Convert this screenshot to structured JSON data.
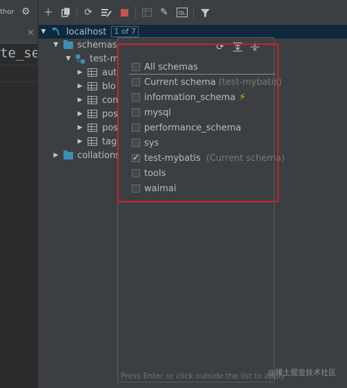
{
  "left": {
    "toolbar_text": "thor",
    "editor_snippet": "te_se"
  },
  "toolbar": {
    "icons": [
      "add-icon",
      "duplicate-icon",
      "refresh-icon",
      "properties-icon",
      "stop-icon",
      "table-view-icon",
      "edit-icon",
      "sql-console-icon",
      "filter-icon"
    ]
  },
  "tree": {
    "host": {
      "label": "localhost",
      "badge": "1 of 7"
    },
    "schemas": {
      "label": "schemas"
    },
    "schema": {
      "label": "test-m"
    },
    "tables": [
      "aut",
      "blo",
      "com",
      "pos",
      "pos",
      "tag"
    ],
    "collations": {
      "label": "collations"
    }
  },
  "popup": {
    "all": {
      "label": "All schemas",
      "checked": false
    },
    "current": {
      "label": "Current schema",
      "note": "(test-mybatis)",
      "checked": false
    },
    "options": [
      {
        "label": "information_schema",
        "checked": false,
        "note": ""
      },
      {
        "label": "mysql",
        "checked": false,
        "note": ""
      },
      {
        "label": "performance_schema",
        "checked": false,
        "note": ""
      },
      {
        "label": "sys",
        "checked": false,
        "note": ""
      },
      {
        "label": "test-mybatis",
        "checked": true,
        "note": "(Current schema)"
      },
      {
        "label": "tools",
        "checked": false,
        "note": ""
      },
      {
        "label": "waimai",
        "checked": false,
        "note": ""
      }
    ],
    "footer": "Press Enter or click outside the list to apply"
  },
  "watermark": "@稀土掘金技术社区",
  "colors": {
    "highlight": "#d0202a",
    "folder": "#3d8fb8",
    "selection": "#0d293e"
  }
}
